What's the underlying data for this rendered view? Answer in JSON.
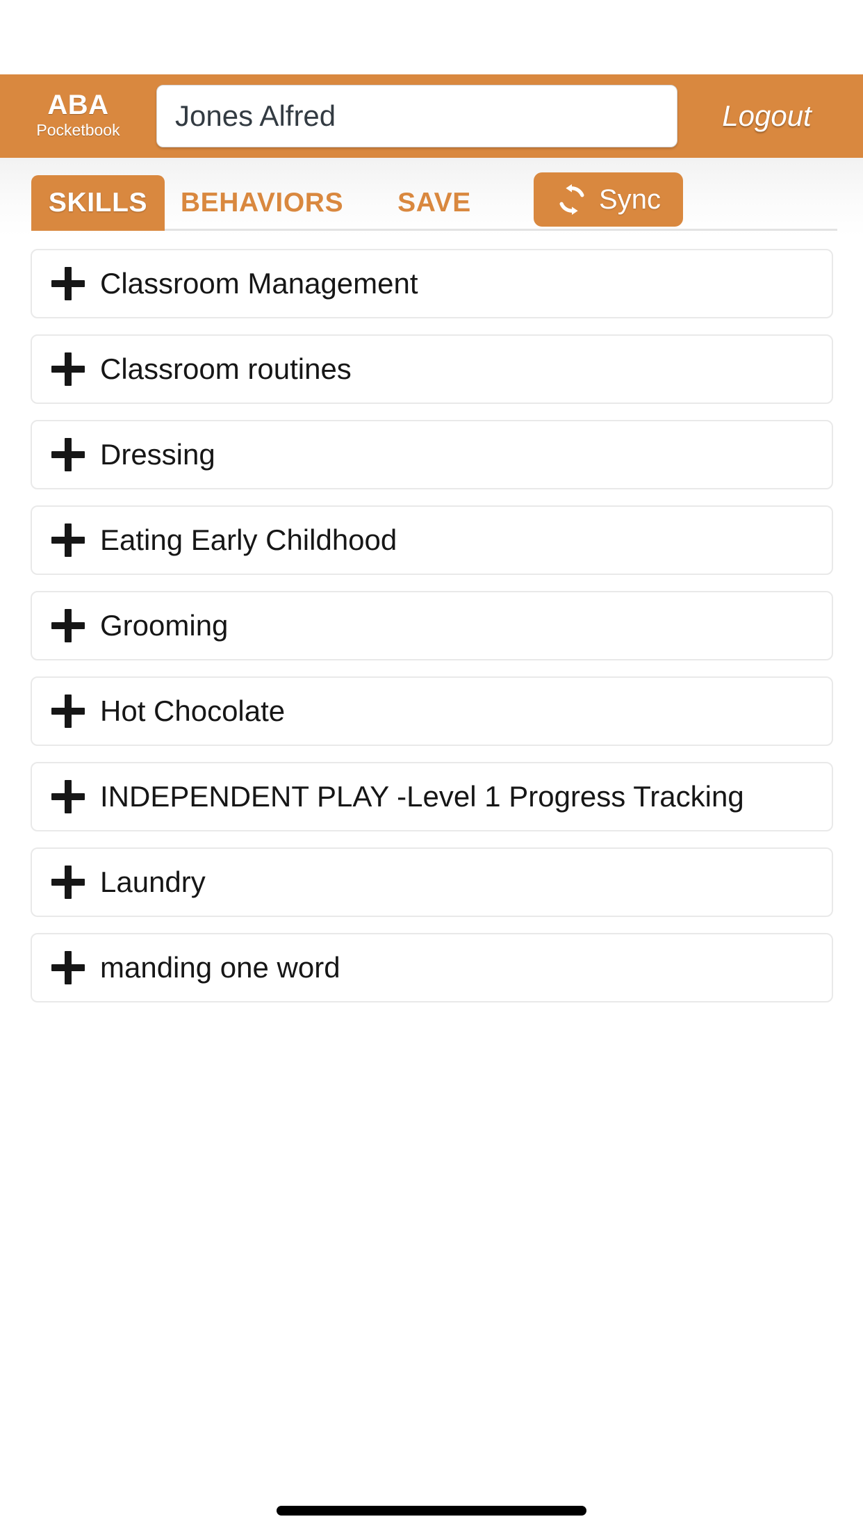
{
  "brand": {
    "title": "ABA",
    "subtitle": "Pocketbook"
  },
  "header": {
    "client_name": "Jones Alfred",
    "client_placeholder": "Jones Alfred",
    "logout_label": "Logout"
  },
  "tabs": [
    {
      "id": "skills",
      "label": "SKILLS",
      "active": true
    },
    {
      "id": "behaviors",
      "label": "BEHAVIORS",
      "active": false
    },
    {
      "id": "save",
      "label": "SAVE",
      "active": false
    }
  ],
  "sync": {
    "label": "Sync",
    "icon": "sync-refresh-icon"
  },
  "skills": {
    "expand_icon": "plus-icon",
    "items": [
      {
        "label": "Classroom Management"
      },
      {
        "label": "Classroom routines"
      },
      {
        "label": "Dressing"
      },
      {
        "label": "Eating Early Childhood"
      },
      {
        "label": "Grooming"
      },
      {
        "label": "Hot Chocolate"
      },
      {
        "label": "INDEPENDENT PLAY -Level 1 Progress Tracking"
      },
      {
        "label": "Laundry"
      },
      {
        "label": "manding one word"
      }
    ]
  },
  "colors": {
    "accent": "#d9883f",
    "text": "#161616",
    "card_border": "#e9e9e9",
    "page_bg": "#ffffff"
  }
}
